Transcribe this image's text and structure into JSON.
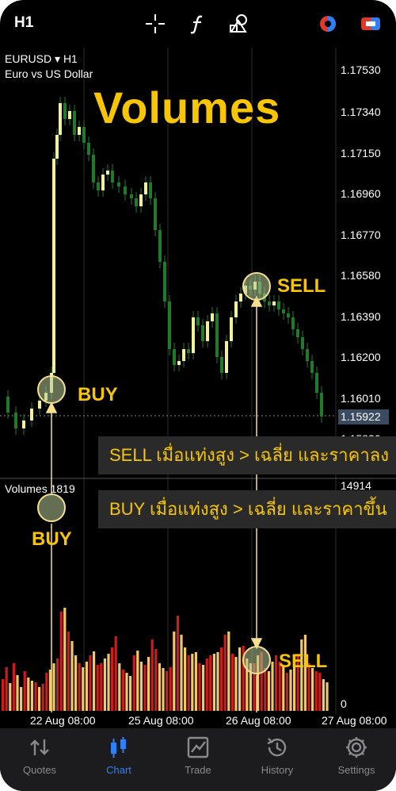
{
  "toolbar": {
    "timeframe": "H1",
    "icons": [
      "crosshair-icon",
      "function-icon",
      "objects-icon",
      "chart-type-icon",
      "trade-toggle-icon"
    ]
  },
  "chart": {
    "symbol": "EURUSD",
    "timeframe": "H1",
    "description": "Euro vs US Dollar",
    "overlay_title": "Volumes",
    "price_axis": [
      "1.17530",
      "1.17340",
      "1.17150",
      "1.16960",
      "1.16770",
      "1.16580",
      "1.16390",
      "1.16200",
      "1.16010",
      "1.15820"
    ],
    "current_price": "1.15922",
    "time_axis": [
      "22 Aug 08:00",
      "25 Aug 08:00",
      "26 Aug 08:00",
      "27 Aug 08:00"
    ],
    "volume_indicator": {
      "name": "Volumes",
      "value": "1819",
      "max": "14914",
      "min": "0"
    }
  },
  "annotations": {
    "sell_label": "SELL",
    "buy_label": "BUY",
    "buy_label_volume": "BUY",
    "sell_label_volume": "SELL",
    "sell_tip": "SELL เมื่อแท่งสูง > เฉลี่ย และราคาลง",
    "buy_tip": "BUY เมื่อแท่งสูง > เฉลี่ย และราคาขึ้น"
  },
  "nav": {
    "items": [
      {
        "label": "Quotes",
        "icon": "quotes-icon",
        "active": false
      },
      {
        "label": "Chart",
        "icon": "chart-icon",
        "active": true
      },
      {
        "label": "Trade",
        "icon": "trade-icon",
        "active": false
      },
      {
        "label": "History",
        "icon": "history-icon",
        "active": false
      },
      {
        "label": "Settings",
        "icon": "settings-icon",
        "active": false
      }
    ]
  },
  "colors": {
    "accent": "#f7c600",
    "nav_active": "#2f7ff5",
    "candle_up": "#f3f0a0",
    "candle_down": "#1f7a2a",
    "volume_up": "#f0c86a",
    "volume_down": "#d11a1a"
  }
}
